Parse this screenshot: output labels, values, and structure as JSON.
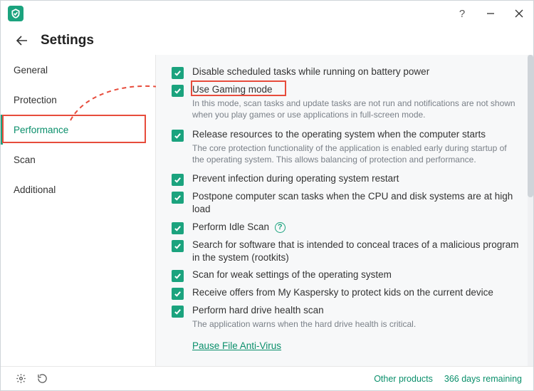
{
  "header": {
    "title": "Settings"
  },
  "sidebar": {
    "items": [
      {
        "label": "General"
      },
      {
        "label": "Protection"
      },
      {
        "label": "Performance"
      },
      {
        "label": "Scan"
      },
      {
        "label": "Additional"
      }
    ]
  },
  "settings": [
    {
      "label": "Disable scheduled tasks while running on battery power",
      "desc": null,
      "help": false
    },
    {
      "label": "Use Gaming mode",
      "desc": "In this mode, scan tasks and update tasks are not run and notifications are not shown when you play games or use applications in full-screen mode.",
      "help": false
    },
    {
      "label": "Release resources to the operating system when the computer starts",
      "desc": "The core protection functionality of the application is enabled early during startup of the operating system. This allows balancing of protection and performance.",
      "help": false
    },
    {
      "label": "Prevent infection during operating system restart",
      "desc": null,
      "help": false
    },
    {
      "label": "Postpone computer scan tasks when the CPU and disk systems are at high load",
      "desc": null,
      "help": false
    },
    {
      "label": "Perform Idle Scan",
      "desc": null,
      "help": true
    },
    {
      "label": "Search for software that is intended to conceal traces of a malicious program in the system (rootkits)",
      "desc": null,
      "help": false
    },
    {
      "label": "Scan for weak settings of the operating system",
      "desc": null,
      "help": false
    },
    {
      "label": "Receive offers from My Kaspersky to protect kids on the current device",
      "desc": null,
      "help": false
    },
    {
      "label": "Perform hard drive health scan",
      "desc": "The application warns when the hard drive health is critical.",
      "help": false
    }
  ],
  "link": {
    "label": "Pause File Anti-Virus"
  },
  "footer": {
    "other": "Other products",
    "days": "366 days remaining"
  }
}
